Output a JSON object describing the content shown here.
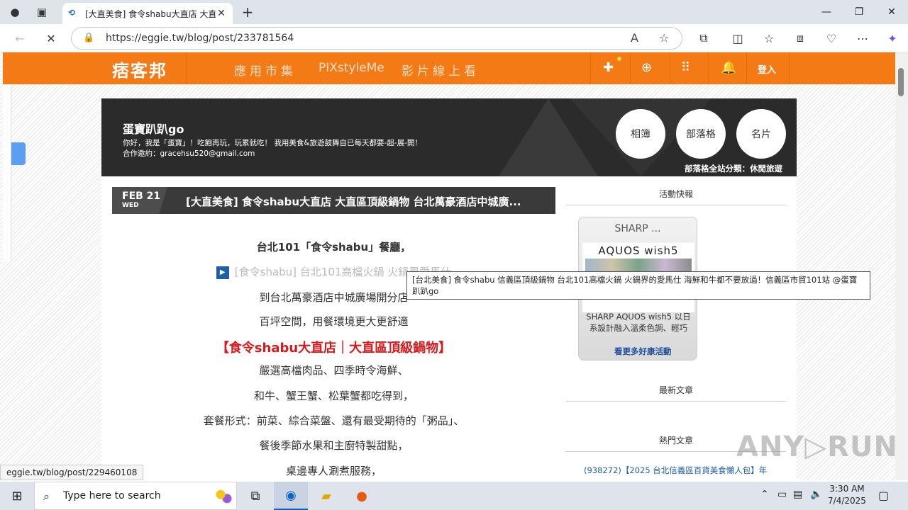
{
  "browser": {
    "tab": {
      "title": "[大直美食] 食令shabu大直店 大直",
      "close": "✕",
      "favicon": "⟲"
    },
    "new_tab": "+",
    "window": {
      "minimize": "—",
      "maximize": "❐",
      "close": "✕"
    },
    "nav": {
      "back": "←",
      "reload": "✕"
    },
    "address": {
      "url": "https://eggie.tw/blog/post/233781564"
    },
    "toolbar_icons": [
      "read-aloud-icon",
      "favorite-star-icon",
      "extensions-icon",
      "split-screen-icon",
      "favorites-icon",
      "collections-icon",
      "browser-essentials-icon",
      "more-icon",
      "copilot-icon"
    ]
  },
  "site_nav": {
    "logo": "痞客邦",
    "links": [
      "應用市集",
      "PIXstyleMe",
      "影片線上看"
    ],
    "login": "登入"
  },
  "blog_header": {
    "name": "蛋寶趴趴go",
    "description": "你好，我是「蛋寶」！吃飽再玩，玩累就吃！ 我用美食&旅遊鼓舞自已每天都要-超-展-開！",
    "contact": "合作邀約：gracehsu520@gmail.com",
    "buttons": [
      "相簿",
      "部落格",
      "名片"
    ],
    "category": "部落格全站分類：休閒旅遊"
  },
  "post": {
    "month_day": "FEB 21",
    "weekday": "WED",
    "title": "[大直美食] 食令shabu大直店 大直區頂級鍋物 台北萬豪酒店中城廣...",
    "lines": [
      "台北101「食令shabu」餐廳，",
      "[食令shabu] 台北101高檔火鍋 火鍋界愛馬仕",
      "到台北萬豪酒店中城廣場開分店",
      "百坪空間，用餐環境更大更舒適",
      "【食令shabu大直店｜大直區頂級鍋物】",
      "嚴選高檔肉品、四季時令海鮮、",
      "和牛、蟹王蟹、松葉蟹都吃得到，",
      "套餐形式：前菜、綜合菜盤、還有最受期待的「粥品」、",
      "餐後季節水果和主廚特製甜點，",
      "桌邊專人涮煮服務，"
    ]
  },
  "sidebar": {
    "activity_title": "活動快報",
    "ad": {
      "title": "SHARP ...",
      "product": "AQUOS wish5",
      "desc": "SHARP AQUOS wish5 以日系設計融入溫柔色調、輕巧",
      "more": "看更多好康活動"
    },
    "latest_title": "最新文章",
    "hot_title": "熱門文章",
    "hot_item": "(938272)【2025 台北信義區百貨美食懶人包】年"
  },
  "tooltip": "[台北美食] 食令shabu 信義區頂級鍋物 台北101高檔火鍋 火鍋界的愛馬仕 海鮮和牛都不要放過！信義區市貿101站 @蛋寶趴趴go",
  "status_url": "eggie.tw/blog/post/229460108",
  "watermark": "ANY▷RUN",
  "taskbar": {
    "search_placeholder": "Type here to search",
    "time": "3:30 AM",
    "date": "7/4/2025"
  }
}
